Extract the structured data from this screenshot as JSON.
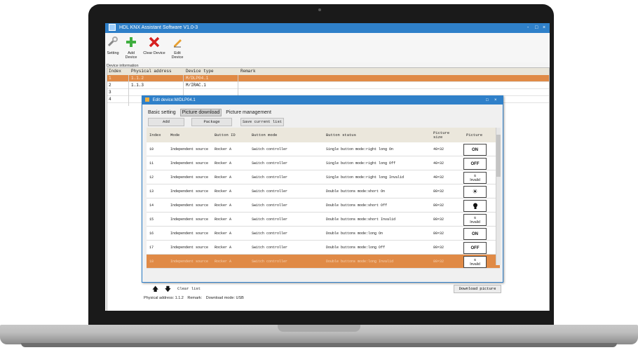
{
  "window": {
    "title": "HDL KNX Assistant Software V1.0-3",
    "controls": [
      "-",
      "□",
      "×"
    ]
  },
  "toolbar": [
    {
      "label": "Setting",
      "icon": "wrench-icon"
    },
    {
      "label": "Add Device",
      "icon": "add-icon"
    },
    {
      "label": "Clear Device",
      "icon": "clear-icon"
    },
    {
      "label": "Edit Device",
      "icon": "pencil-icon"
    }
  ],
  "device_info": {
    "label": "Device information",
    "columns": [
      "Index",
      "Physical address",
      "Device type",
      "Remark"
    ],
    "rows": [
      {
        "index": "1",
        "address": "1.1.2",
        "type": "M/DLP04.1",
        "remark": ""
      },
      {
        "index": "2",
        "address": "1.1.3",
        "type": "M/IRAC.1",
        "remark": ""
      },
      {
        "index": "3",
        "address": "",
        "type": "",
        "remark": ""
      },
      {
        "index": "4",
        "address": "",
        "type": "",
        "remark": ""
      }
    ]
  },
  "dialog": {
    "title": "Edit device:M/DLP04.1",
    "controls": [
      "□",
      "×"
    ],
    "tabs": [
      "Basic setting",
      "Picture download",
      "Picture management"
    ],
    "active_tab": "Picture download",
    "buttons": {
      "add": "Add",
      "package": "Package",
      "save": "Save current list"
    },
    "columns": [
      "Index",
      "Mode",
      "Button ID",
      "Button mode",
      "Button status",
      "Picture size",
      "Picture"
    ],
    "rows": [
      {
        "index": "10",
        "mode": "Independent source",
        "button_id": "Rocker A",
        "button_mode": "Switch controller",
        "status": "Single button mode:right long On",
        "size": "40×32",
        "picture": "ON"
      },
      {
        "index": "11",
        "mode": "Independent source",
        "button_id": "Rocker A",
        "button_mode": "Switch controller",
        "status": "Single button mode:right long Off",
        "size": "40×32",
        "picture": "OFF"
      },
      {
        "index": "12",
        "mode": "Independent source",
        "button_id": "Rocker A",
        "button_mode": "Switch controller",
        "status": "Single button mode:right long Invalid",
        "size": "40×32",
        "picture": "Invalid"
      },
      {
        "index": "13",
        "mode": "Independent source",
        "button_id": "Rocker A",
        "button_mode": "Switch controller",
        "status": "Double buttons mode:short On",
        "size": "80×32",
        "picture": "sun-icon"
      },
      {
        "index": "14",
        "mode": "Independent source",
        "button_id": "Rocker A",
        "button_mode": "Switch controller",
        "status": "Double buttons mode:short Off",
        "size": "80×32",
        "picture": "bulb-icon"
      },
      {
        "index": "15",
        "mode": "Independent source",
        "button_id": "Rocker A",
        "button_mode": "Switch controller",
        "status": "Double buttons mode:short Invalid",
        "size": "80×32",
        "picture": "Invalid"
      },
      {
        "index": "16",
        "mode": "Independent source",
        "button_id": "Rocker A",
        "button_mode": "Switch controller",
        "status": "Double buttons mode:long On",
        "size": "80×32",
        "picture": "ON"
      },
      {
        "index": "17",
        "mode": "Independent source",
        "button_id": "Rocker A",
        "button_mode": "Switch controller",
        "status": "Double buttons mode:long Off",
        "size": "80×32",
        "picture": "OFF"
      },
      {
        "index": "18",
        "mode": "Independent source",
        "button_id": "Rocker A",
        "button_mode": "Switch controller",
        "status": "Double buttons mode:long Invalid",
        "size": "80×32",
        "picture": "Invalid"
      }
    ],
    "selected_index": "18",
    "clear_list": "Clear list",
    "download": "Download picture",
    "status": {
      "physical_address": "Physical address: 1.1.2",
      "remark": "Remark:",
      "download_mode": "Download mode: USB"
    }
  },
  "colors": {
    "titlebar": "#2f80c9",
    "selection": "#e08a46"
  }
}
